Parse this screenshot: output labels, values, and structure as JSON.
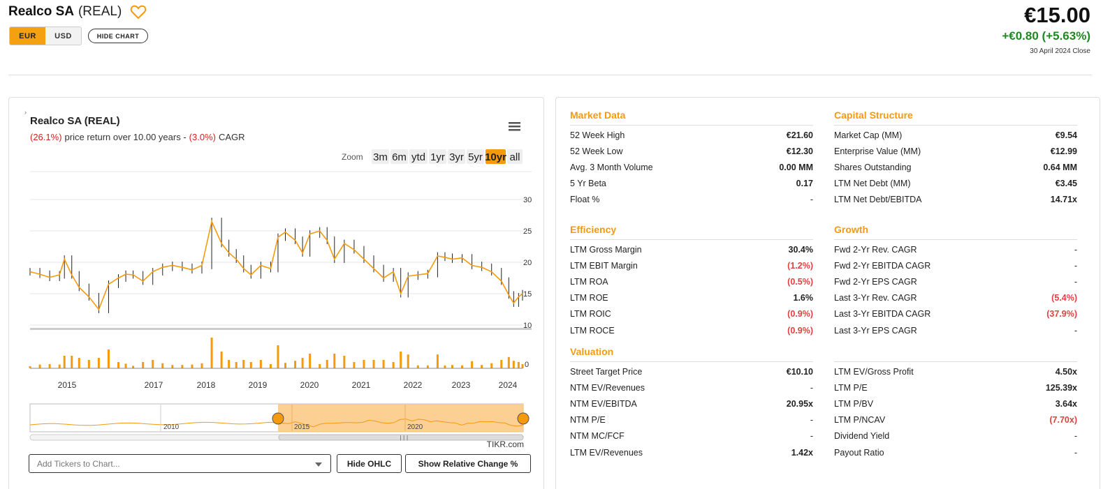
{
  "header": {
    "company_name": "Realco SA",
    "ticker": "(REAL)",
    "currency_options": [
      "EUR",
      "USD"
    ],
    "selected_currency": "EUR",
    "hide_chart_label": "HIDE CHART",
    "price": "€15.00",
    "change": "+€0.80 (+5.63%)",
    "close_note": "30 April 2024 Close"
  },
  "chart": {
    "title": "Realco SA (REAL)",
    "return_pct": "(26.1%)",
    "return_text": "price return over 10.00 years -",
    "cagr_pct": "(3.0%)",
    "cagr_text": "CAGR",
    "zoom_label": "Zoom",
    "zoom_options": [
      "3m",
      "6m",
      "ytd",
      "1yr",
      "3yr",
      "5yr",
      "10yr",
      "all"
    ],
    "selected_zoom": "10yr",
    "credit": "TIKR.com",
    "navigator_labels": [
      "2010",
      "2015",
      "2020"
    ],
    "add_tickers_placeholder": "Add Tickers to Chart...",
    "hide_ohlc_label": "Hide OHLC",
    "relative_change_label": "Show Relative Change %",
    "accent_color": "#f59a0c"
  },
  "chart_data": {
    "type": "line",
    "title": "Realco SA (REAL)",
    "x_ticks": [
      "2015",
      "2017",
      "2018",
      "2019",
      "2020",
      "2021",
      "2022",
      "2023",
      "2024"
    ],
    "y_ticks": [
      10,
      15,
      20,
      25,
      30
    ],
    "ylim": [
      10,
      30
    ],
    "volume_axis_label": "0",
    "series": [
      {
        "x": [
          2014.3,
          2014.5,
          2014.7,
          2014.9,
          2015.0,
          2015.15,
          2015.3,
          2015.5,
          2015.7,
          2015.9,
          2016.1,
          2016.25,
          2016.4,
          2016.6,
          2016.8,
          2017.0,
          2017.2,
          2017.4,
          2017.6,
          2017.8,
          2018.0,
          2018.2,
          2018.35,
          2018.5,
          2018.65,
          2018.8,
          2019.0,
          2019.2,
          2019.35,
          2019.5,
          2019.7,
          2019.85,
          2020.0,
          2020.2,
          2020.35,
          2020.5,
          2020.7,
          2020.9,
          2021.1,
          2021.3,
          2021.5,
          2021.7,
          2021.85,
          2022.0,
          2022.2,
          2022.4,
          2022.6,
          2022.75,
          2022.9,
          2023.1,
          2023.3,
          2023.5,
          2023.7,
          2023.9,
          2024.05,
          2024.15,
          2024.25,
          2024.33
        ],
        "values": [
          18.5,
          18.1,
          17.6,
          18.0,
          20.5,
          18.0,
          16.0,
          14.5,
          12.5,
          16.5,
          17.5,
          18.1,
          18.0,
          17.0,
          18.5,
          19.2,
          19.5,
          19.2,
          18.8,
          19.5,
          26.5,
          23.0,
          21.5,
          20.5,
          19.0,
          18.0,
          19.5,
          19.0,
          24.0,
          24.8,
          23.5,
          21.5,
          24.5,
          25.0,
          23.5,
          20.5,
          23.0,
          22.0,
          20.5,
          19.0,
          17.5,
          18.5,
          15.0,
          17.8,
          18.0,
          18.2,
          21.0,
          20.8,
          20.5,
          20.7,
          19.5,
          19.2,
          18.5,
          17.0,
          14.8,
          13.5,
          14.5,
          15.0
        ],
        "name": ""
      }
    ]
  },
  "stats": {
    "market_data": {
      "title": "Market Data",
      "rows": [
        {
          "label": "52 Week High",
          "value": "€21.60"
        },
        {
          "label": "52 Week Low",
          "value": "€12.30"
        },
        {
          "label": "Avg. 3 Month Volume",
          "value": "0.00 MM"
        },
        {
          "label": "5 Yr Beta",
          "value": "0.17"
        },
        {
          "label": "Float %",
          "value": "-"
        }
      ]
    },
    "capital_structure": {
      "title": "Capital Structure",
      "rows": [
        {
          "label": "Market Cap (MM)",
          "value": "€9.54"
        },
        {
          "label": "Enterprise Value (MM)",
          "value": "€12.99"
        },
        {
          "label": "Shares Outstanding",
          "value": "0.64 MM"
        },
        {
          "label": "LTM Net Debt (MM)",
          "value": "€3.45"
        },
        {
          "label": "LTM Net Debt/EBITDA",
          "value": "14.71x"
        }
      ]
    },
    "efficiency": {
      "title": "Efficiency",
      "rows": [
        {
          "label": "LTM Gross Margin",
          "value": "30.4%"
        },
        {
          "label": "LTM EBIT Margin",
          "value": "(1.2%)"
        },
        {
          "label": "LTM ROA",
          "value": "(0.5%)"
        },
        {
          "label": "LTM ROE",
          "value": "1.6%"
        },
        {
          "label": "LTM ROIC",
          "value": "(0.9%)"
        },
        {
          "label": "LTM ROCE",
          "value": "(0.9%)"
        }
      ]
    },
    "growth": {
      "title": "Growth",
      "rows": [
        {
          "label": "Fwd 2-Yr Rev. CAGR",
          "value": "-"
        },
        {
          "label": "Fwd 2-Yr EBITDA CAGR",
          "value": "-"
        },
        {
          "label": "Fwd 2-Yr EPS CAGR",
          "value": "-"
        },
        {
          "label": "Last 3-Yr Rev. CAGR",
          "value": "(5.4%)"
        },
        {
          "label": "Last 3-Yr EBITDA CAGR",
          "value": "(37.9%)"
        },
        {
          "label": "Last 3-Yr EPS CAGR",
          "value": "-"
        }
      ]
    },
    "valuation": {
      "title": "Valuation",
      "left_rows": [
        {
          "label": "Street Target Price",
          "value": "€10.10"
        },
        {
          "label": "NTM EV/Revenues",
          "value": "-"
        },
        {
          "label": "NTM EV/EBITDA",
          "value": "20.95x"
        },
        {
          "label": "NTM P/E",
          "value": "-"
        },
        {
          "label": "NTM MC/FCF",
          "value": "-"
        },
        {
          "label": "LTM EV/Revenues",
          "value": "1.42x"
        }
      ],
      "right_rows": [
        {
          "label": "LTM EV/Gross Profit",
          "value": "4.50x"
        },
        {
          "label": "LTM P/E",
          "value": "125.39x"
        },
        {
          "label": "LTM P/BV",
          "value": "3.64x"
        },
        {
          "label": "LTM P/NCAV",
          "value": "(7.70x)"
        },
        {
          "label": "Dividend Yield",
          "value": "-"
        },
        {
          "label": "Payout Ratio",
          "value": "-"
        }
      ]
    }
  }
}
